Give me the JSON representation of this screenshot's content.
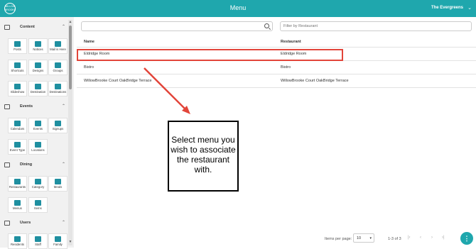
{
  "app": {
    "logo_text": "WILLOW BROOKE",
    "title": "Menu",
    "community": "The Evergreens"
  },
  "sidebar": {
    "sections": [
      {
        "title": "Content",
        "items": [
          "Posts",
          "Notices",
          "Mail is Here",
          "Shortcuts",
          "Designs",
          "Groups",
          "Slideshow",
          "Destination",
          "Destinations"
        ]
      },
      {
        "title": "Events",
        "items": [
          "Calendars",
          "Events",
          "Signups",
          "Event Type",
          "Locations"
        ]
      },
      {
        "title": "Dining",
        "items": [
          "Restaurants",
          "Category",
          "Meals",
          "Menus",
          "Items"
        ]
      },
      {
        "title": "Users",
        "items": [
          "Residents",
          "Staff",
          "Family"
        ]
      }
    ]
  },
  "main": {
    "search_placeholder": "",
    "filter_placeholder": "Filter by Restaurant",
    "columns": [
      "Name",
      "Restaurant"
    ],
    "rows": [
      [
        "Eldridge Room",
        "Eldridge Room"
      ],
      [
        "Bistro",
        "Bistro"
      ],
      [
        "WillowBrooke Court OakBridge Terrace",
        "WillowBrooke Court OakBridge Terrace"
      ]
    ]
  },
  "callout": {
    "text": "Select menu you wish to associate the restaurant with."
  },
  "pagination": {
    "items_per_page_label": "Items per page:",
    "items_per_page": "10",
    "range": "1-3 of 3"
  },
  "colors": {
    "brand": "#1fa7ad",
    "highlight": "#e2453a"
  },
  "icons": [
    "search-icon",
    "chevron-down-icon",
    "chevron-up-icon",
    "help-icon"
  ]
}
